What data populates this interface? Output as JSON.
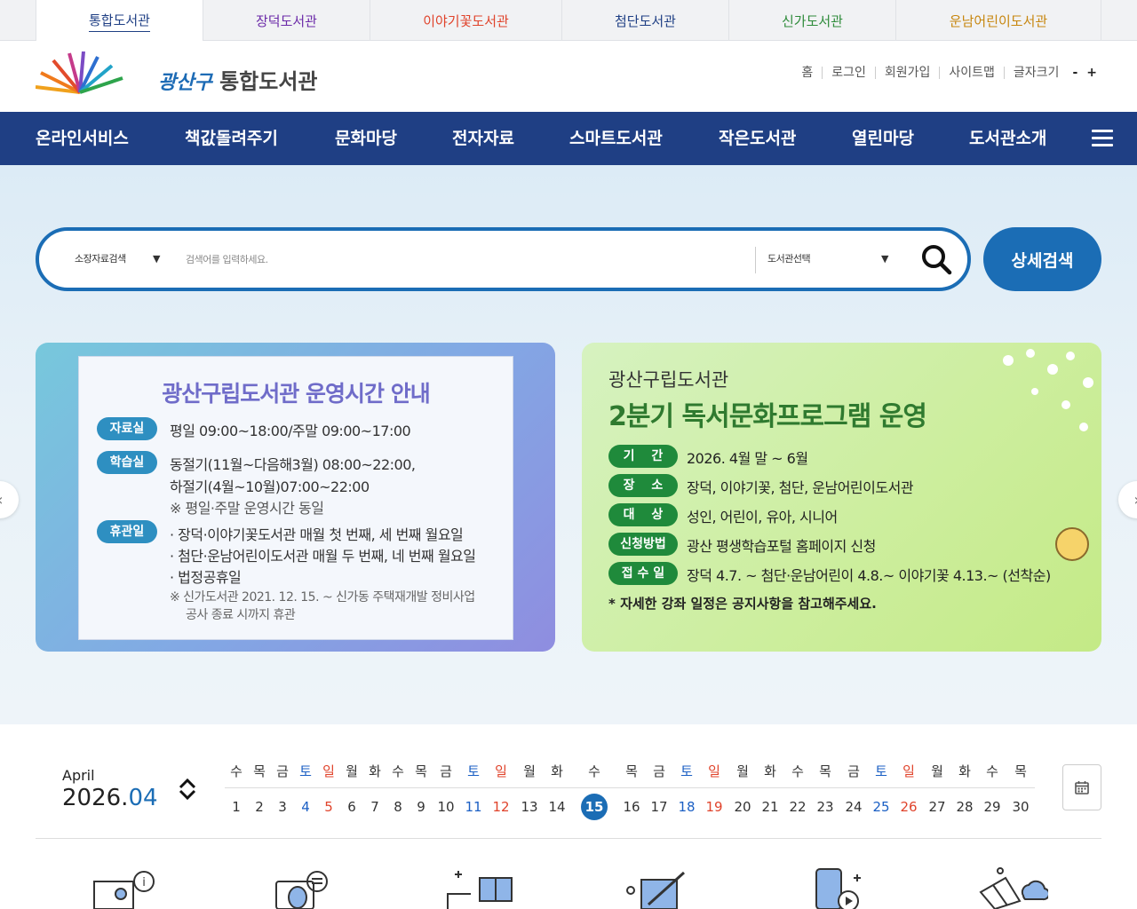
{
  "library_tabs": [
    {
      "label": "통합도서관",
      "color": "#1f3f84"
    },
    {
      "label": "장덕도서관",
      "color": "#6b2aa8"
    },
    {
      "label": "이야기꽃도서관",
      "color": "#e0432b"
    },
    {
      "label": "첨단도서관",
      "color": "#1f3f84"
    },
    {
      "label": "신가도서관",
      "color": "#2e8b3a"
    },
    {
      "label": "운남어린이도서관",
      "color": "#c7860e"
    }
  ],
  "header": {
    "logo_text_part1": "광산구",
    "logo_text_part2": " 통합도서관",
    "links": [
      "홈",
      "로그인",
      "회원가입",
      "사이트맵"
    ],
    "font_size_label": "글자크기",
    "font_minus": "-",
    "font_plus": "+"
  },
  "gnb": [
    "온라인서비스",
    "책값돌려주기",
    "문화마당",
    "전자자료",
    "스마트도서관",
    "작은도서관",
    "열린마당",
    "도서관소개"
  ],
  "search": {
    "type_select": "소장자료검색",
    "placeholder": "검색어를 입력하세요.",
    "library_select": "도서관선택",
    "detail_button": "상세검색",
    "dropdown_arrow": "▼"
  },
  "banner1": {
    "title": "광산구립도서관 운영시간 안내",
    "rows": [
      {
        "badge": "자료실",
        "lines": [
          "평일 09:00~18:00/주말 09:00~17:00"
        ]
      },
      {
        "badge": "학습실",
        "lines": [
          "동절기(11월~다음해3월) 08:00~22:00,",
          "하절기(4월~10월)07:00~22:00"
        ]
      },
      {
        "badge": "휴관일",
        "lines": [
          "· 장덕·이야기꽃도서관 매월 첫 번째, 세 번째 월요일",
          "· 첨단·운남어린이도서관 매월 두 번째, 네 번째 월요일",
          "· 법정공휴일"
        ]
      }
    ],
    "note_weekend": "※ 평일·주말 운영시간 동일",
    "note_closure": [
      "※ 신가도서관 2021. 12. 15. ~ 신가동 주택재개발 정비사업",
      "공사 종료 시까지 휴관"
    ]
  },
  "banner2": {
    "subtitle": "광산구립도서관",
    "title": "2분기 독서문화프로그램 운영",
    "rows": [
      {
        "badge": "기　 간",
        "value": "2026. 4월 말 ~ 6월"
      },
      {
        "badge": "장　 소",
        "value": "장덕, 이야기꽃, 첨단, 운남어린이도서관"
      },
      {
        "badge": "대　 상",
        "value": "성인, 어린이, 유아, 시니어"
      },
      {
        "badge": "신청방법",
        "value": "광산 평생학습포털 홈페이지 신청"
      },
      {
        "badge": "접 수 일",
        "value": "장덕 4.7. ~ 첨단·운남어린이 4.8.~ 이야기꽃 4.13.~ (선착순)"
      }
    ],
    "note": "* 자세한 강좌 일정은 공지사항을 참고해주세요."
  },
  "calendar": {
    "month_name": "April",
    "year": "2026.",
    "month": "04",
    "today": 15,
    "days": [
      {
        "d": "1",
        "w": "수"
      },
      {
        "d": "2",
        "w": "목"
      },
      {
        "d": "3",
        "w": "금"
      },
      {
        "d": "4",
        "w": "토"
      },
      {
        "d": "5",
        "w": "일"
      },
      {
        "d": "6",
        "w": "월"
      },
      {
        "d": "7",
        "w": "화"
      },
      {
        "d": "8",
        "w": "수"
      },
      {
        "d": "9",
        "w": "목"
      },
      {
        "d": "10",
        "w": "금"
      },
      {
        "d": "11",
        "w": "토"
      },
      {
        "d": "12",
        "w": "일"
      },
      {
        "d": "13",
        "w": "월"
      },
      {
        "d": "14",
        "w": "화"
      },
      {
        "d": "15",
        "w": "수"
      },
      {
        "d": "16",
        "w": "목"
      },
      {
        "d": "17",
        "w": "금"
      },
      {
        "d": "18",
        "w": "토"
      },
      {
        "d": "19",
        "w": "일"
      },
      {
        "d": "20",
        "w": "월"
      },
      {
        "d": "21",
        "w": "화"
      },
      {
        "d": "22",
        "w": "수"
      },
      {
        "d": "23",
        "w": "목"
      },
      {
        "d": "24",
        "w": "금"
      },
      {
        "d": "25",
        "w": "토"
      },
      {
        "d": "26",
        "w": "일"
      },
      {
        "d": "27",
        "w": "월"
      },
      {
        "d": "28",
        "w": "화"
      },
      {
        "d": "29",
        "w": "수"
      },
      {
        "d": "30",
        "w": "목"
      }
    ]
  },
  "icons": {
    "search": "search-icon",
    "menu": "hamburger-icon",
    "calendar": "calendar-icon",
    "prev": "chevron-left-icon",
    "next": "chevron-right-icon",
    "quick_menu": [
      "info-desk-icon",
      "book-request-icon",
      "book-add-icon",
      "edit-board-icon",
      "mobile-media-icon",
      "ebook-cloud-icon"
    ]
  },
  "colors": {
    "primary": "#1f3f84",
    "accent": "#1b6db5",
    "saturday": "#1b5fc4",
    "sunday": "#e0432b"
  }
}
